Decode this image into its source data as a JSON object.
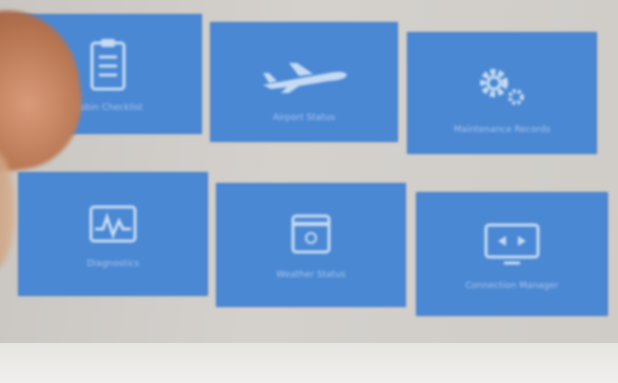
{
  "colors": {
    "tile_bg": "#4a88d4",
    "tile_text": "#a9c5ea"
  },
  "tiles": [
    {
      "label": "Cabin Checklist",
      "icon": "clipboard-icon"
    },
    {
      "label": "Airport Status",
      "icon": "airplane-icon"
    },
    {
      "label": "Maintenance Records",
      "icon": "gears-icon"
    },
    {
      "label": "Diagnostics",
      "icon": "pulse-monitor-icon"
    },
    {
      "label": "Weather Status",
      "icon": "calendar-window-icon"
    },
    {
      "label": "Connection Manager",
      "icon": "display-arrows-icon"
    }
  ]
}
